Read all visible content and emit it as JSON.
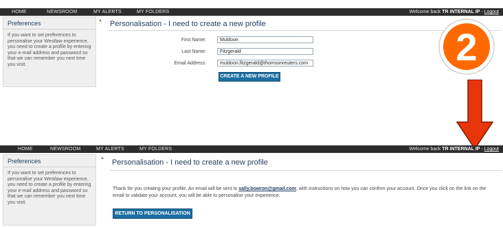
{
  "nav": {
    "items": [
      "HOME",
      "NEWSROOM",
      "MY ALERTS",
      "MY FOLDERS"
    ],
    "welcome_prefix": "Welcome back ",
    "user": "TR INTERNAL IP",
    "separator": " - ",
    "logout": "Logout"
  },
  "sidebar": {
    "title": "Preferences",
    "text": "If you want to set preferences to personalise your Westlaw experience, you need to create a profile by entering your e-mail address and password so that we can remember you next time you visit."
  },
  "step1": {
    "heading": "Personalisation - I need to create a new profile",
    "fields": [
      {
        "label": "First Name:",
        "value": "Muldoon"
      },
      {
        "label": "Last Name:",
        "value": "Fitzgerald"
      },
      {
        "label": "Email Address:",
        "value": "muldoon.fitzgerald@thomsonreuters.com"
      }
    ],
    "create_button": "CREATE A NEW PROFILE"
  },
  "step2": {
    "heading": "Personalisation - I need to create a new profile",
    "message_before": "Thank for you creating your profile. An email will be sent to ",
    "email": "sally.bowron@gmail.com",
    "message_after": ", with instructions on how you can confirm your account. Once you click on the link on the email to validate your account, you will be able to personalise your experience.",
    "return_button": "RETURN TO PERSONALISATION"
  },
  "annotation": {
    "step_number": "2",
    "badge_color": "#ff6a00",
    "arrow_color": "#e8350c"
  }
}
